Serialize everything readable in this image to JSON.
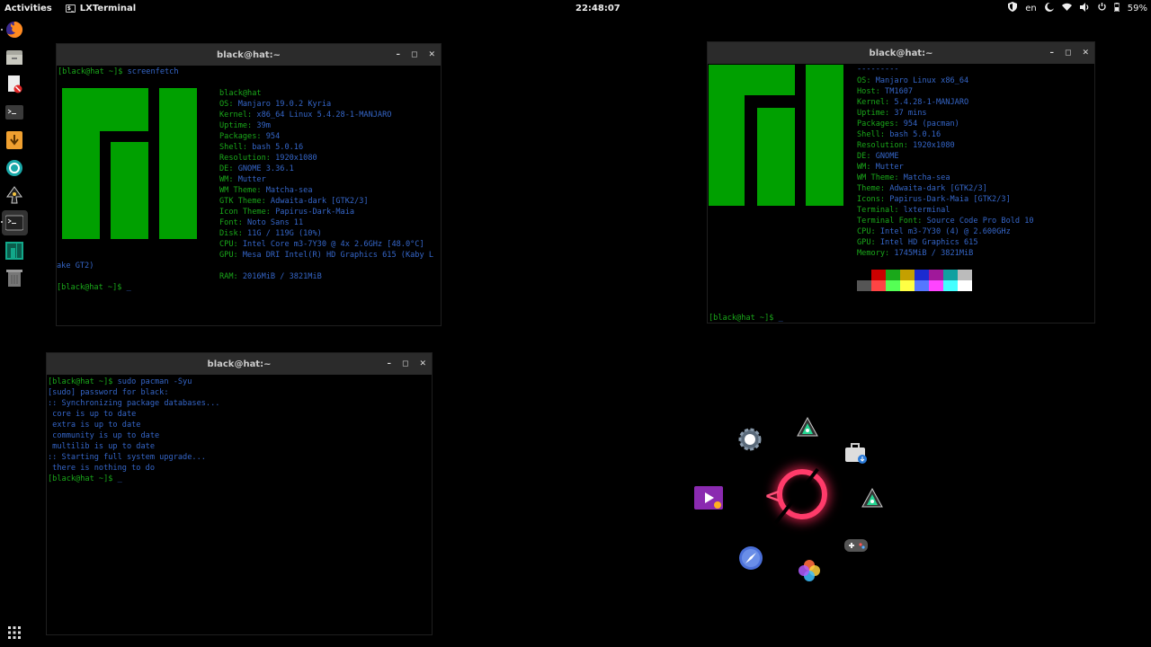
{
  "topbar": {
    "activities": "Activities",
    "app_name": "LXTerminal",
    "app_icon_glyph": "$_",
    "clock": "22:48:07",
    "lang": "en",
    "battery": "59%"
  },
  "terminals": {
    "t1": {
      "title": "black@hat:~",
      "prompt1": "[black@hat ~]$",
      "cmd1": " screenfetch",
      "info": [
        {
          "k": "",
          "v": "black@hat"
        },
        {
          "k": "OS:",
          "v": " Manjaro 19.0.2 Kyria"
        },
        {
          "k": "Kernel:",
          "v": " x86_64 Linux 5.4.28-1-MANJARO"
        },
        {
          "k": "Uptime:",
          "v": " 39m"
        },
        {
          "k": "Packages:",
          "v": " 954"
        },
        {
          "k": "Shell:",
          "v": " bash 5.0.16"
        },
        {
          "k": "Resolution:",
          "v": " 1920x1080"
        },
        {
          "k": "DE:",
          "v": " GNOME 3.36.1"
        },
        {
          "k": "WM:",
          "v": " Mutter"
        },
        {
          "k": "WM Theme:",
          "v": " Matcha-sea"
        },
        {
          "k": "GTK Theme:",
          "v": " Adwaita-dark [GTK2/3]"
        },
        {
          "k": "Icon Theme:",
          "v": " Papirus-Dark-Maia"
        },
        {
          "k": "Font:",
          "v": " Noto Sans 11"
        },
        {
          "k": "Disk:",
          "v": " 11G / 119G (10%)"
        },
        {
          "k": "CPU:",
          "v": " Intel Core m3-7Y30 @ 4x 2.6GHz [48.0°C]"
        },
        {
          "k": "GPU:",
          "v": " Mesa DRI Intel(R) HD Graphics 615 (Kaby L"
        }
      ],
      "wrap": "ake GT2)",
      "ram_k": "RAM:",
      "ram_v": " 2016MiB / 3821MiB",
      "prompt2": "[black@hat ~]$",
      "cursor": " _"
    },
    "t2": {
      "title": "black@hat:~",
      "separator": "---------",
      "info": [
        {
          "k": "OS:",
          "v": " Manjaro Linux x86_64"
        },
        {
          "k": "Host:",
          "v": " TM1607"
        },
        {
          "k": "Kernel:",
          "v": " 5.4.28-1-MANJARO"
        },
        {
          "k": "Uptime:",
          "v": " 37 mins"
        },
        {
          "k": "Packages:",
          "v": " 954 (pacman)"
        },
        {
          "k": "Shell:",
          "v": " bash 5.0.16"
        },
        {
          "k": "Resolution:",
          "v": " 1920x1080"
        },
        {
          "k": "DE:",
          "v": " GNOME"
        },
        {
          "k": "WM:",
          "v": " Mutter"
        },
        {
          "k": "WM Theme:",
          "v": " Matcha-sea"
        },
        {
          "k": "Theme:",
          "v": " Adwaita-dark [GTK2/3]"
        },
        {
          "k": "Icons:",
          "v": " Papirus-Dark-Maia [GTK2/3]"
        },
        {
          "k": "Terminal:",
          "v": " lxterminal"
        },
        {
          "k": "Terminal Font:",
          "v": " Source Code Pro Bold 10"
        },
        {
          "k": "CPU:",
          "v": " Intel m3-7Y30 (4) @ 2.600GHz"
        },
        {
          "k": "GPU:",
          "v": " Intel HD Graphics 615"
        },
        {
          "k": "Memory:",
          "v": " 1745MiB / 3821MiB"
        }
      ],
      "palette_row1": [
        "#000000",
        "#cc0000",
        "#1aa81a",
        "#c4a000",
        "#1b2bd0",
        "#a0189a",
        "#10a0a0",
        "#bbbbbb"
      ],
      "palette_row2": [
        "#555555",
        "#ff4444",
        "#55ff55",
        "#ffff44",
        "#5577ff",
        "#ff44ff",
        "#44ffff",
        "#ffffff"
      ],
      "prompt": "[black@hat ~]$",
      "cursor": " _"
    },
    "t3": {
      "title": "black@hat:~",
      "lines": [
        {
          "p": "[black@hat ~]$",
          "t": " sudo pacman -Syu"
        },
        {
          "p": "",
          "t": "[sudo] password for black:"
        },
        {
          "p": "",
          "t": ":: Synchronizing package databases..."
        },
        {
          "p": "",
          "t": " core is up to date"
        },
        {
          "p": "",
          "t": " extra is up to date"
        },
        {
          "p": "",
          "t": " community is up to date"
        },
        {
          "p": "",
          "t": " multilib is up to date"
        },
        {
          "p": "",
          "t": ":: Starting full system upgrade..."
        },
        {
          "p": "",
          "t": " there is nothing to do"
        },
        {
          "p": "[black@hat ~]$",
          "t": " _"
        }
      ]
    }
  },
  "colors": {
    "manjaro_green": "#00a000",
    "prompt_green": "#1aa81a",
    "text_blue": "#3566c8",
    "ring_pink": "#ff3b6a"
  },
  "window_controls": {
    "minimize": "–",
    "maximize": "◻",
    "close": "✕"
  }
}
